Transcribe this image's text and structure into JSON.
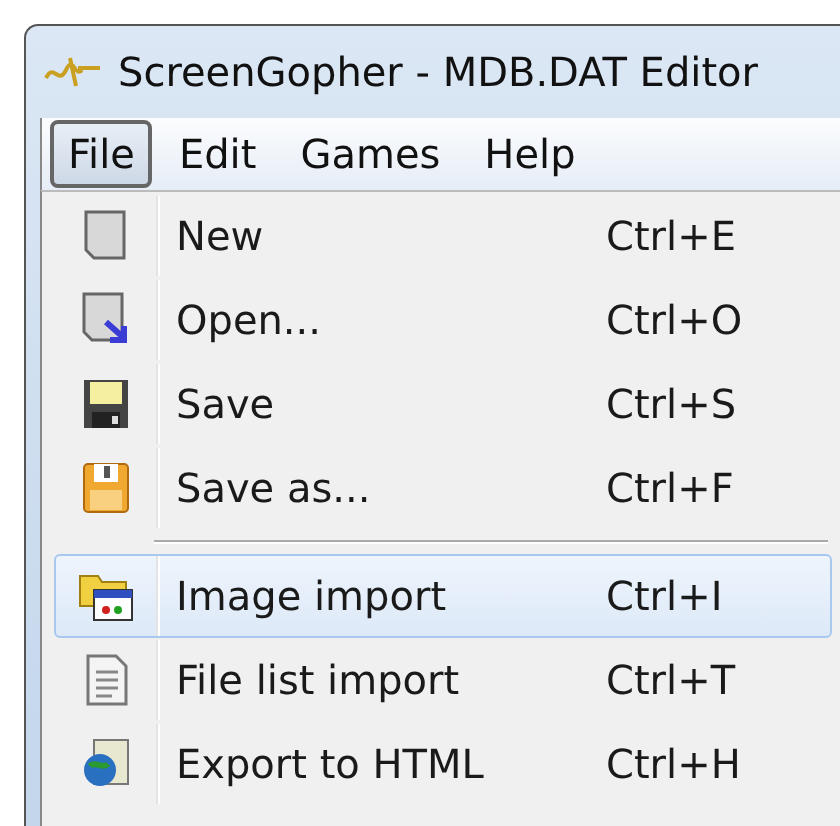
{
  "window": {
    "title": "ScreenGopher - MDB.DAT Editor"
  },
  "menu_bar": [
    {
      "label": "File",
      "selected": true
    },
    {
      "label": "Edit",
      "selected": false
    },
    {
      "label": "Games",
      "selected": false
    },
    {
      "label": "Help",
      "selected": false
    }
  ],
  "file_menu": [
    {
      "kind": "item",
      "label": "New",
      "shortcut": "Ctrl+E",
      "selected": false
    },
    {
      "kind": "item",
      "label": "Open...",
      "shortcut": "Ctrl+O",
      "selected": false
    },
    {
      "kind": "item",
      "label": "Save",
      "shortcut": "Ctrl+S",
      "selected": false
    },
    {
      "kind": "item",
      "label": "Save as...",
      "shortcut": "Ctrl+F",
      "selected": false
    },
    {
      "kind": "separator"
    },
    {
      "kind": "item",
      "label": "Image import",
      "shortcut": "Ctrl+I",
      "selected": true
    },
    {
      "kind": "item",
      "label": "File list import",
      "shortcut": "Ctrl+T",
      "selected": false
    },
    {
      "kind": "item",
      "label": "Export to HTML",
      "shortcut": "Ctrl+H",
      "selected": false
    }
  ]
}
